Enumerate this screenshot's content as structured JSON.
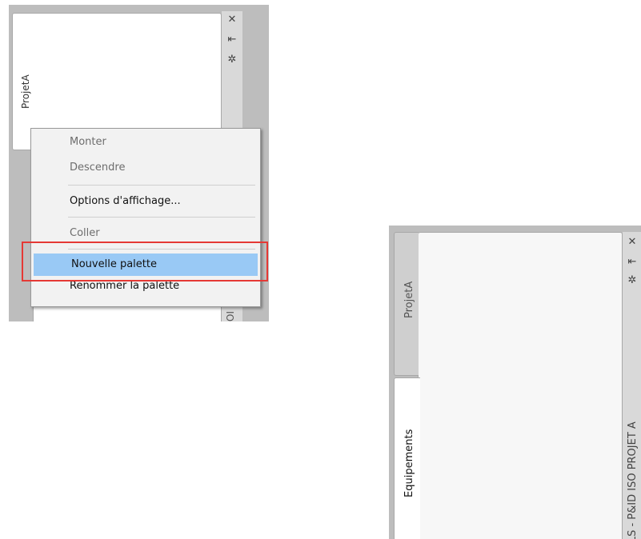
{
  "left_palette": {
    "tab_label": "ProjetA",
    "strip_partial_label": "OI",
    "controls": {
      "close": "✕",
      "pin": "⇤",
      "settings": "✲"
    },
    "context_menu": {
      "items": [
        {
          "label": "Monter",
          "enabled": false,
          "selected": false
        },
        {
          "label": "Descendre",
          "enabled": false,
          "selected": false
        },
        {
          "label": "Options d'affichage...",
          "enabled": true,
          "selected": false
        },
        {
          "label": "Coller",
          "enabled": false,
          "selected": false
        },
        {
          "label": "Nouvelle palette",
          "enabled": true,
          "selected": true
        },
        {
          "label": "Renommer la palette",
          "enabled": true,
          "selected": false
        }
      ]
    },
    "highlight_color": "#e53935"
  },
  "right_palette": {
    "tabs": [
      {
        "label": "ProjetA",
        "active": false
      },
      {
        "label": "Equipements",
        "active": true
      }
    ],
    "strip_label": "ILS - P&ID ISO PROJET A",
    "controls": {
      "close": "✕",
      "pin": "⇤",
      "settings": "✲"
    }
  },
  "colors": {
    "selection": "#99c9f5",
    "panel_bg": "#bdbdbd"
  }
}
